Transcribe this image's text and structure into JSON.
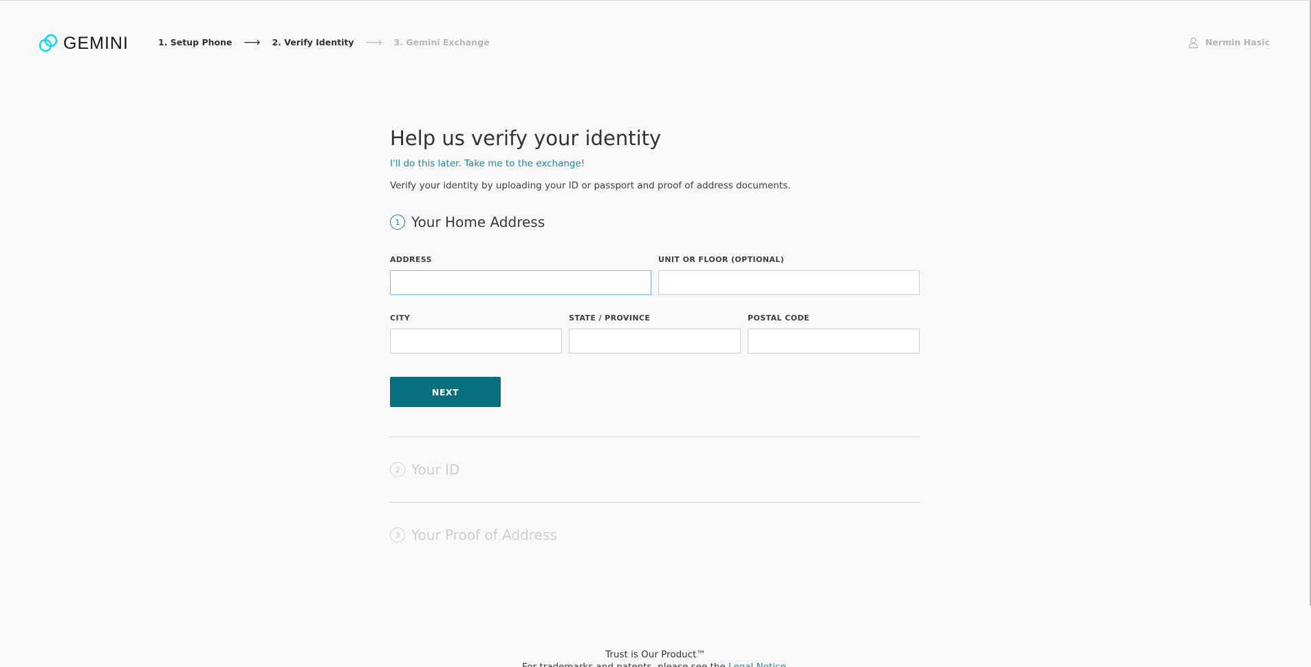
{
  "header": {
    "logo_text": "GEMINI",
    "steps": [
      {
        "label": "1. Setup Phone",
        "state": "done"
      },
      {
        "label": "2. Verify Identity",
        "state": "current"
      },
      {
        "label": "3. Gemini Exchange",
        "state": "future"
      }
    ],
    "arrow_glyph": "⟶",
    "user_name": "Nermin Hasic"
  },
  "main": {
    "title": "Help us verify your identity",
    "skip_link": "I'll do this later. Take me to the exchange!",
    "intro": "Verify your identity by uploading your ID or passport and proof of address documents.",
    "sections": [
      {
        "number": "1",
        "title": "Your Home Address",
        "state": "active"
      },
      {
        "number": "2",
        "title": "Your ID",
        "state": "locked"
      },
      {
        "number": "3",
        "title": "Your Proof of Address",
        "state": "locked"
      }
    ],
    "form": {
      "address": {
        "label": "ADDRESS",
        "value": ""
      },
      "unit": {
        "label": "UNIT OR FLOOR (OPTIONAL)",
        "value": ""
      },
      "city": {
        "label": "CITY",
        "value": ""
      },
      "state": {
        "label": "STATE / PROVINCE",
        "value": ""
      },
      "postal": {
        "label": "POSTAL CODE",
        "value": ""
      },
      "next_label": "NEXT"
    }
  },
  "footer": {
    "tagline": "Trust is Our Product™",
    "legal_prefix": "For trademarks and patents, please see the",
    "legal_link": "Legal Notice",
    "legal_suffix": "."
  },
  "colors": {
    "accent": "#086f7f",
    "link": "#1b8a99",
    "logo_mark": "#00dcfa",
    "background": "#f9f9f9"
  },
  "icons": {
    "logo": "gemini-logo-icon",
    "user": "user-icon"
  }
}
